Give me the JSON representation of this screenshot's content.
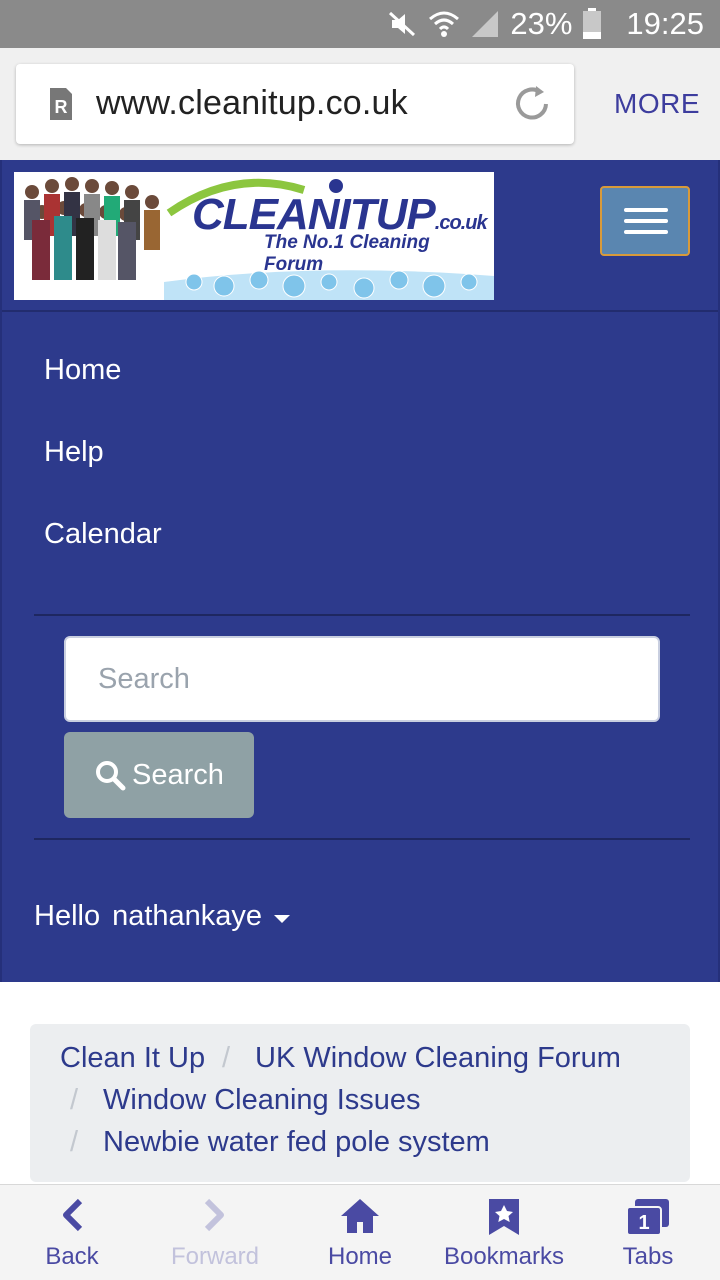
{
  "status_bar": {
    "battery_percent": "23%",
    "time": "19:25"
  },
  "browser": {
    "url": "www.cleanitup.co.uk",
    "more_label": "MORE"
  },
  "site": {
    "logo": {
      "brand_main": "CLEANITUP",
      "brand_suffix": ".co.uk",
      "tagline": "The No.1 Cleaning Forum"
    },
    "nav_items": [
      "Home",
      "Help",
      "Calendar"
    ],
    "search": {
      "placeholder": "Search",
      "button_label": "Search"
    },
    "user_menu": {
      "greeting": "Hello",
      "username": "nathankaye"
    }
  },
  "breadcrumb": {
    "items": [
      "Clean It Up",
      "UK Window Cleaning Forum",
      "Window Cleaning Issues",
      "Newbie water fed pole system"
    ],
    "separator": "/"
  },
  "toolbar": {
    "items": [
      {
        "label": "Back",
        "icon": "back-chevron-icon",
        "enabled": true
      },
      {
        "label": "Forward",
        "icon": "forward-chevron-icon",
        "enabled": false
      },
      {
        "label": "Home",
        "icon": "home-icon",
        "enabled": true
      },
      {
        "label": "Bookmarks",
        "icon": "bookmark-star-icon",
        "enabled": true
      },
      {
        "label": "Tabs",
        "icon": "tabs-icon",
        "enabled": true,
        "count": "1"
      }
    ]
  },
  "colors": {
    "nav_background": "#2d3a8c",
    "link": "#2d3a8c",
    "toolbar_accent": "#4a4aa3",
    "search_button": "#8fa1a5",
    "hamburger": "#5a86b0"
  }
}
